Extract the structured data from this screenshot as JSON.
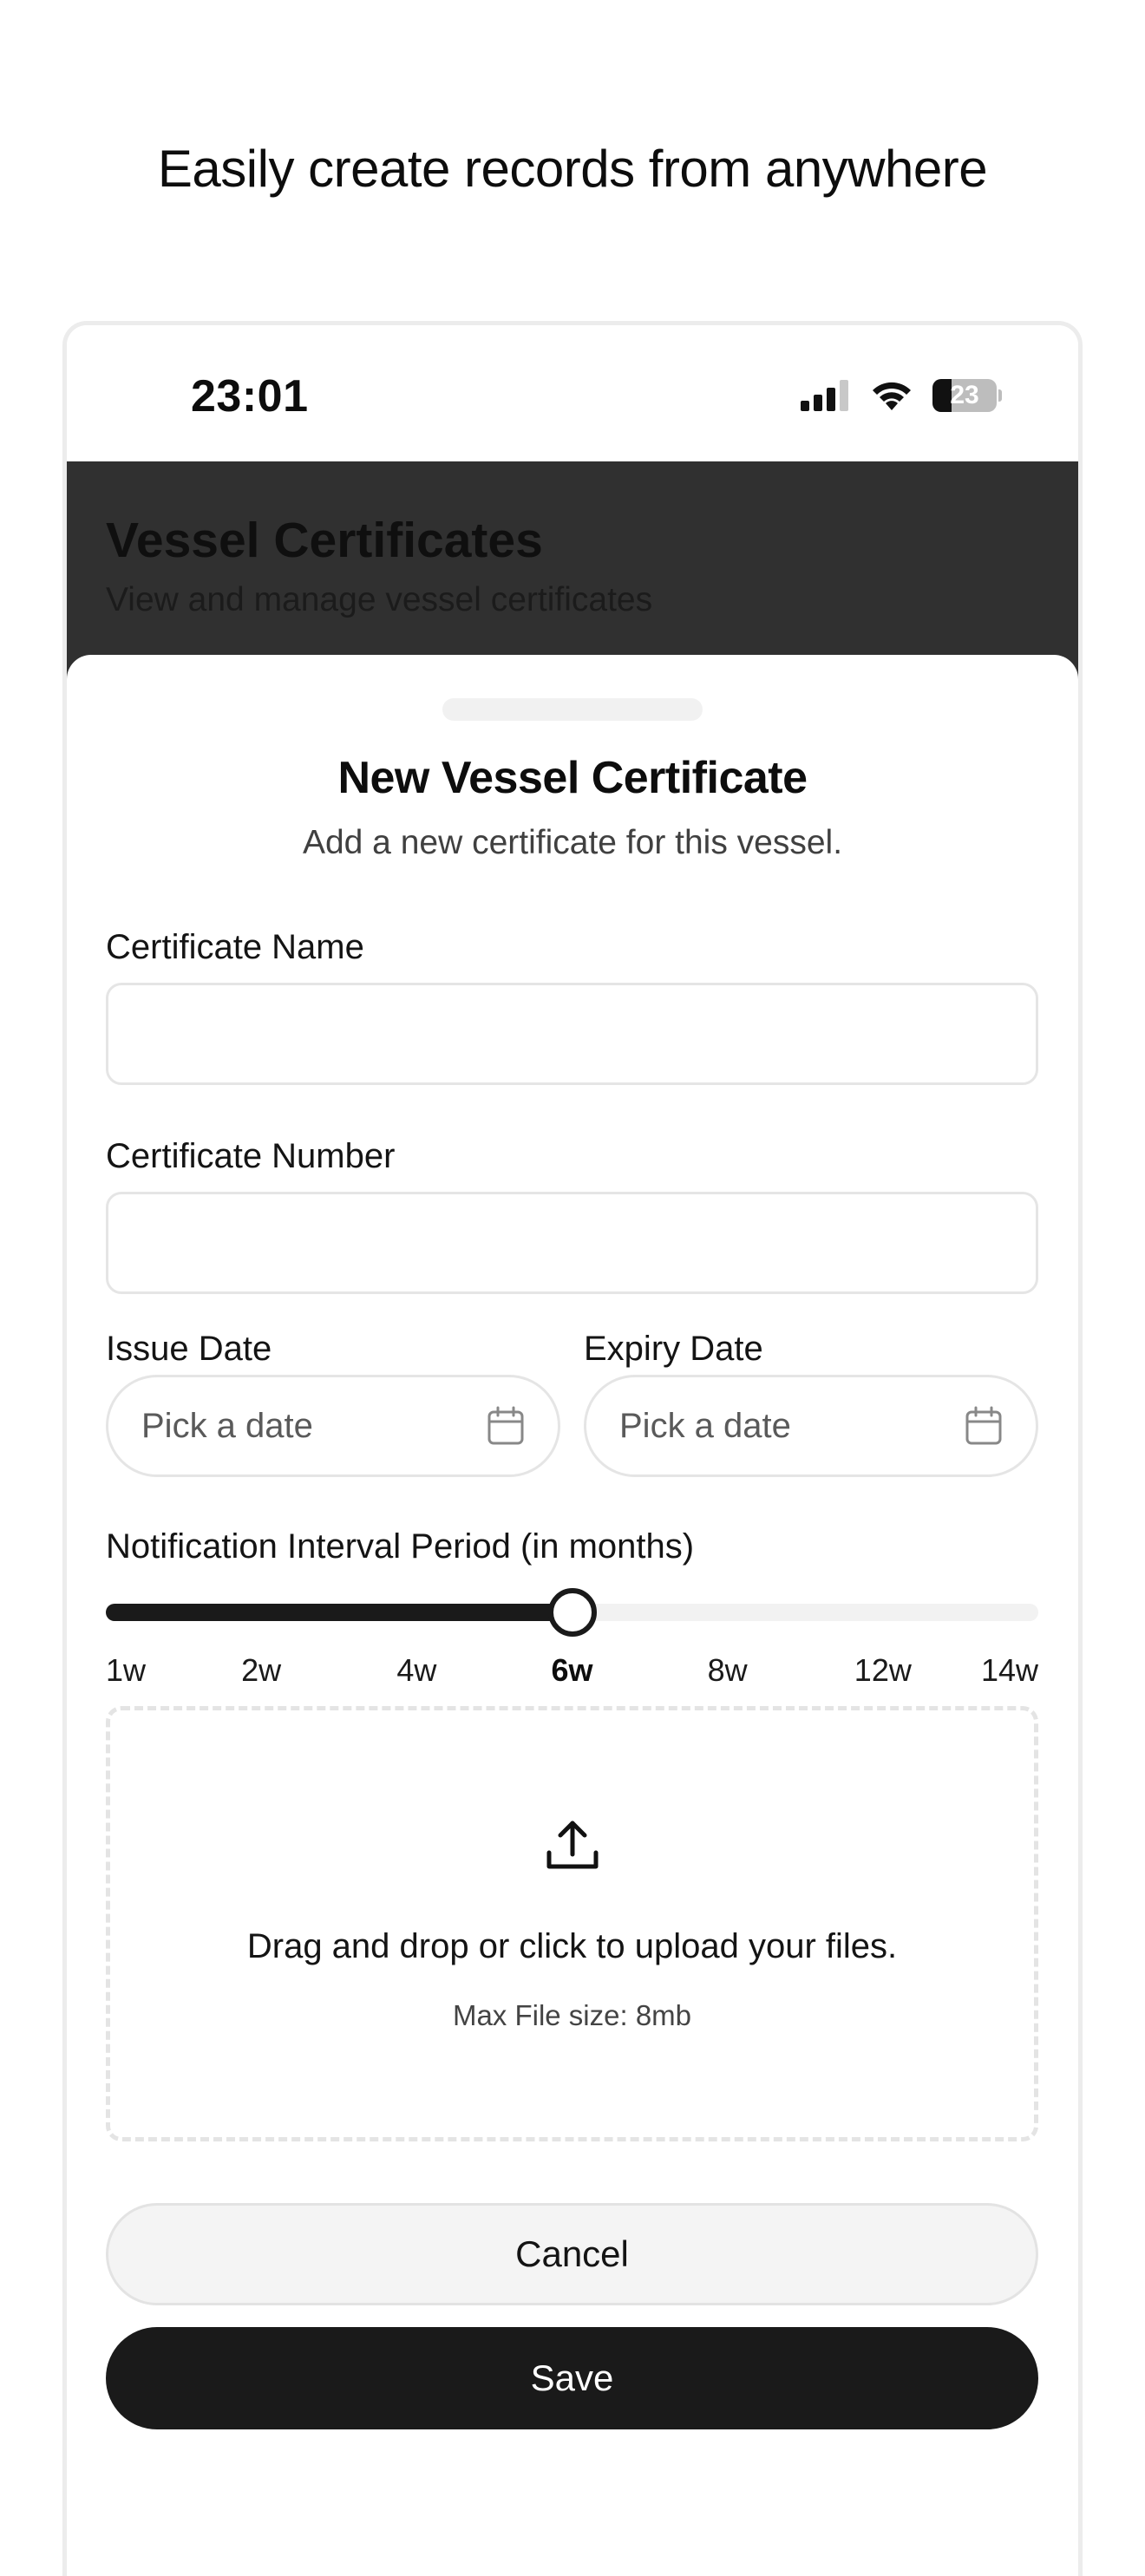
{
  "headline": "Easily create records from anywhere",
  "status_bar": {
    "time": "23:01",
    "battery_level": "23"
  },
  "background_screen": {
    "title": "Vessel Certificates",
    "subtitle": "View and manage vessel certificates"
  },
  "sheet": {
    "title": "New Vessel Certificate",
    "description": "Add a new certificate for this vessel.",
    "certificate_name": {
      "label": "Certificate Name",
      "value": ""
    },
    "certificate_number": {
      "label": "Certificate Number",
      "value": ""
    },
    "issue_date": {
      "label": "Issue Date",
      "placeholder": "Pick a date"
    },
    "expiry_date": {
      "label": "Expiry Date",
      "placeholder": "Pick a date"
    },
    "notification_interval": {
      "label": "Notification Interval Period (in months)",
      "ticks": [
        "1w",
        "2w",
        "4w",
        "6w",
        "8w",
        "12w",
        "14w"
      ],
      "selected": "6w",
      "selected_index": 3
    },
    "upload": {
      "instruction": "Drag and drop or click to upload your files.",
      "limit": "Max File size: 8mb"
    },
    "cancel_label": "Cancel",
    "save_label": "Save"
  },
  "colors": {
    "primary": "#1a1a1a",
    "overlay": "#303030",
    "border": "#e5e5e5"
  },
  "icons": {
    "calendar": "calendar-icon",
    "upload": "upload-icon",
    "signal": "cellular-signal-icon",
    "wifi": "wifi-icon",
    "battery": "battery-icon"
  }
}
